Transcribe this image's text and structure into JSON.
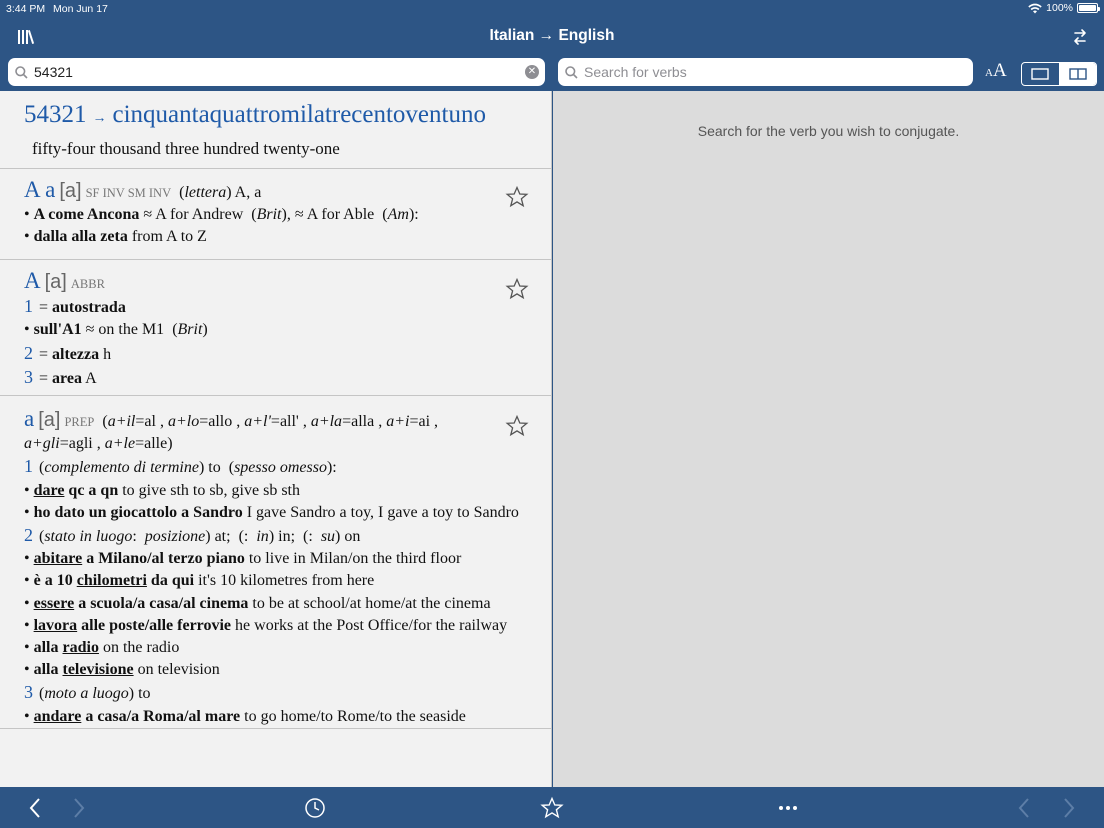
{
  "status": {
    "time": "3:44 PM",
    "date": "Mon Jun 17",
    "battery": "100%"
  },
  "nav": {
    "title": "Italian → English"
  },
  "search": {
    "value": "54321",
    "verb_placeholder": "Search for verbs"
  },
  "fontsize": {
    "small": "A",
    "big": "A"
  },
  "number_entry": {
    "number": "54321",
    "arrow": "→",
    "word": "cinquantaquattromilatrecentoventuno",
    "translation": "fifty-four thousand three hundred twenty-one"
  },
  "entry1": {
    "headword": "A a",
    "pron": "[a]",
    "pos": "sf inv sm inv",
    "gloss_note": "lettera",
    "gloss": "A, a",
    "ex1_it": "A come Ancona",
    "ex1_en1": "A for Andrew",
    "ex1_note1": "Brit",
    "ex1_en2": "A for Able",
    "ex1_note2": "Am",
    "ex2_it": "dalla alla zeta",
    "ex2_en": "from A to Z"
  },
  "entry2": {
    "headword": "A",
    "pron": "[a]",
    "pos": "abbr",
    "s1_num": "1",
    "s1_text": "autostrada",
    "ex1_it": "sull'A1",
    "ex1_en": "on the M1",
    "ex1_note": "Brit",
    "s2_num": "2",
    "s2_text": "altezza",
    "s2_en": "h",
    "s3_num": "3",
    "s3_text": "area",
    "s3_en": "A"
  },
  "entry3": {
    "headword": "a",
    "pron": "[a]",
    "pos": "prep",
    "contractions": [
      {
        "f": "a+il",
        "r": "al"
      },
      {
        "f": "a+lo",
        "r": "allo"
      },
      {
        "f": "a+l'",
        "r": "all'"
      },
      {
        "f": "a+la",
        "r": "alla"
      },
      {
        "f": "a+i",
        "r": "ai"
      },
      {
        "f": "a+gli",
        "r": "agli"
      },
      {
        "f": "a+le",
        "r": "alle"
      }
    ],
    "s1_num": "1",
    "s1_note": "complemento di termine",
    "s1_to": "to",
    "s1_note2": "spesso omesso",
    "s1_ex1_u": "dare",
    "s1_ex1_b": "qc a qn",
    "s1_ex1_en": "to give sth to sb, give sb sth",
    "s1_ex2_b": "ho dato un giocattolo a Sandro",
    "s1_ex2_en": "I gave Sandro a toy, I gave a toy to Sandro",
    "s2_num": "2",
    "s2_note1": "stato in luogo",
    "s2_note2": "posizione",
    "s2_at": "at;",
    "s2_in_lbl": "in",
    "s2_in": "in;",
    "s2_su_lbl": "su",
    "s2_on": "on",
    "s2_ex1_u": "abitare",
    "s2_ex1_b": "a Milano/al terzo piano",
    "s2_ex1_en": "to live in Milan/on the third floor",
    "s2_ex2_b1": "è a 10",
    "s2_ex2_u": "chilometri",
    "s2_ex2_b2": "da qui",
    "s2_ex2_en": "it's 10 kilometres from here",
    "s2_ex3_u": "essere",
    "s2_ex3_b": "a scuola/a casa/al cinema",
    "s2_ex3_en": "to be at school/at home/at the cinema",
    "s2_ex4_u": "lavora",
    "s2_ex4_b": "alle poste/alle ferrovie",
    "s2_ex4_en": "he works at the Post Office/for the railway",
    "s2_ex5_b": "alla",
    "s2_ex5_u": "radio",
    "s2_ex5_en": "on the radio",
    "s2_ex6_b": "alla",
    "s2_ex6_u": "televisione",
    "s2_ex6_en": "on television",
    "s3_num": "3",
    "s3_note": "moto a luogo",
    "s3_to": "to",
    "s3_ex1_u": "andare",
    "s3_ex1_b": "a casa/a Roma/al mare",
    "s3_ex1_en": "to go home/to Rome/to the seaside"
  },
  "right": {
    "hint": "Search for the verb you wish to conjugate."
  },
  "icons": [
    "library-icon",
    "switch-direction-icon",
    "search-icon",
    "clear-icon",
    "single-pane-icon",
    "split-pane-icon",
    "star-icon",
    "back-icon",
    "forward-icon",
    "history-icon",
    "more-icon"
  ]
}
